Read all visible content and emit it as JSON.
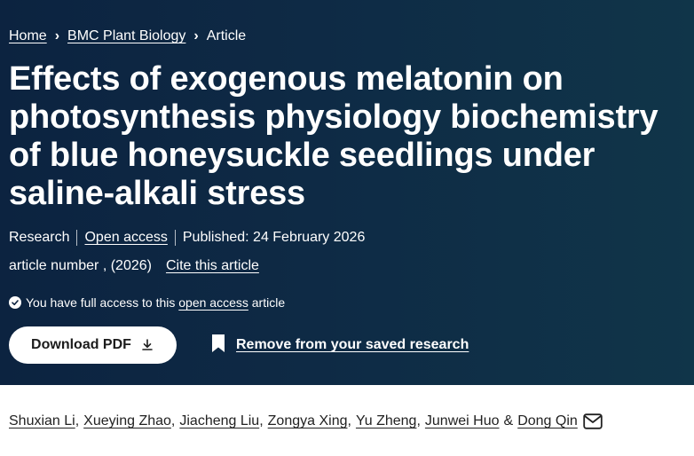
{
  "breadcrumb": {
    "items": [
      "Home",
      "BMC Plant Biology"
    ],
    "current": "Article",
    "separator": "›"
  },
  "article": {
    "title": "Effects of exogenous melatonin on photosynthesis physiology biochemistry of blue honeysuckle seedlings under saline-alkali stress",
    "type": "Research",
    "access_label": "Open access",
    "published": "Published: 24 February 2026",
    "article_number": "article number , (2026)",
    "cite_label": "Cite this article",
    "access_notice": {
      "before": "You have full access to this",
      "link": "open access",
      "after": "article"
    }
  },
  "actions": {
    "download_label": "Download PDF",
    "save_label": "Remove from your saved research"
  },
  "authors": {
    "list": [
      "Shuxian Li",
      "Xueying Zhao",
      "Jiacheng Liu",
      "Zongya Xing",
      "Yu Zheng",
      "Junwei Huo"
    ],
    "last": "Dong Qin",
    "conjunction": "&"
  },
  "icons": [
    "check-circle-icon",
    "download-icon",
    "bookmark-icon",
    "mail-icon"
  ],
  "colors": {
    "hero_background": "#0c2340",
    "hero_text": "#ffffff",
    "button_bg": "#ffffff",
    "body_text": "#222222"
  }
}
